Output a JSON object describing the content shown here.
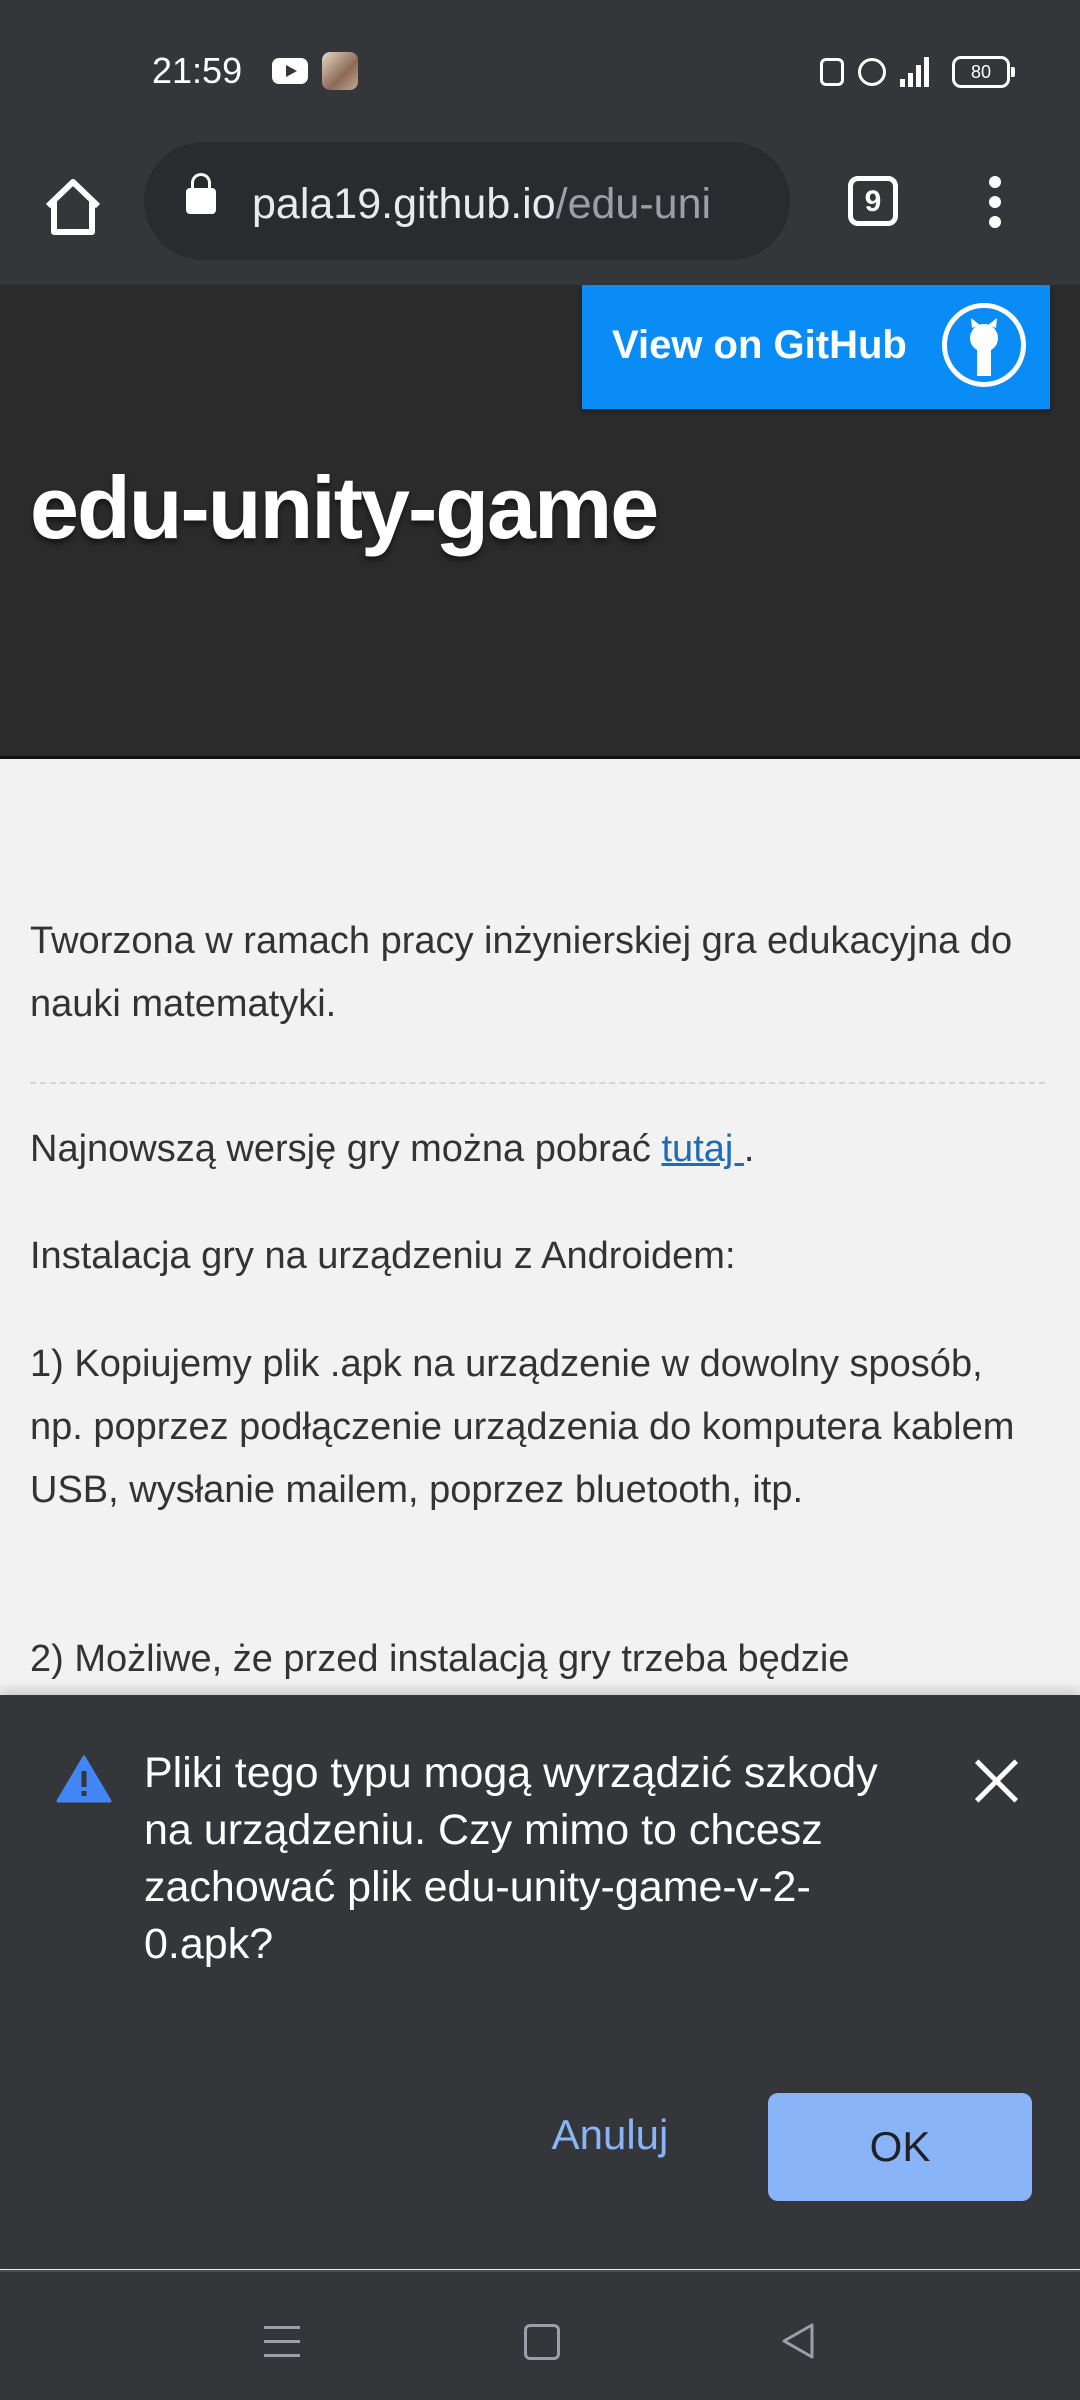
{
  "status_bar": {
    "time": "21:59",
    "battery": "80",
    "icons": [
      "youtube-icon",
      "avatar-icon",
      "nfc-icon",
      "alarm-icon",
      "lte-signal-icon",
      "battery-icon"
    ]
  },
  "browser": {
    "url_host": "pala19.github.io",
    "url_path": "/edu-uni",
    "tab_count": "9",
    "icons": [
      "home-icon",
      "lock-icon",
      "more-vert-icon"
    ]
  },
  "page": {
    "github_button": "View on GitHub",
    "title": "edu-unity-game",
    "intro": "Tworzona w ramach pracy inżynierskiej gra edukacyjna do nauki matematyki.",
    "download_text": "Najnowszą wersję gry można pobrać ",
    "download_link": "tutaj ",
    "download_end": ".",
    "install_heading": "Instalacja gry na urządzeniu z Androidem:",
    "step1": "1) Kopiujemy plik .apk na urządzenie w dowolny sposób, np. poprzez podłączenie urządzenia do komputera kablem USB, wysłanie mailem, poprzez bluetooth, itp.",
    "step2": "2) Możliwe, że przed instalacją gry trzeba będzie"
  },
  "download_prompt": {
    "message": "Pliki tego typu mogą wyrządzić szkody na urządzeniu. Czy mimo to chcesz zachować plik edu-unity-game-v-2-0.apk?",
    "cancel_label": "Anuluj",
    "ok_label": "OK",
    "accent_color": "#8ab4f8",
    "warning_color": "#4285f4"
  },
  "colors": {
    "toolbar": "#35363a",
    "github_button": "#0a8cf6",
    "header": "#2b2b2b",
    "link": "#1e6bb8"
  }
}
